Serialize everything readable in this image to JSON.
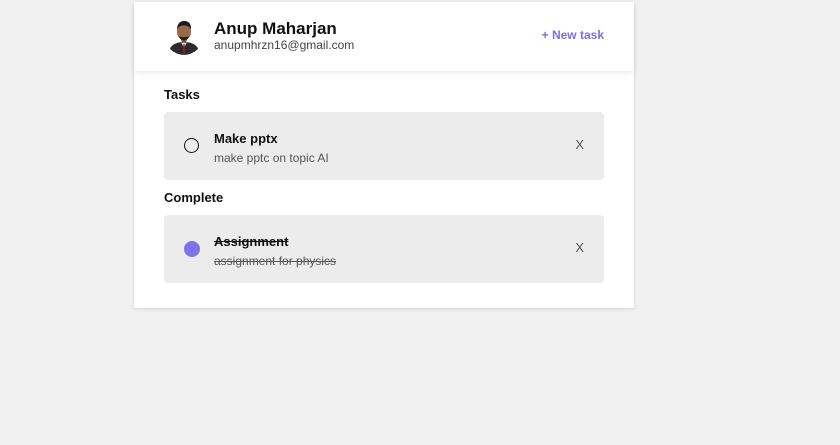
{
  "user": {
    "name": "Anup Maharjan",
    "email": "anupmhrzn16@gmail.com"
  },
  "header": {
    "new_task_label": "+ New task"
  },
  "sections": {
    "tasks_title": "Tasks",
    "complete_title": "Complete"
  },
  "tasks": [
    {
      "title": "Make pptx",
      "description": "make pptc on topic AI",
      "completed": false,
      "delete_label": "X"
    }
  ],
  "completed": [
    {
      "title": "Assignment",
      "description": "assignment for physics",
      "completed": true,
      "delete_label": "X"
    }
  ],
  "colors": {
    "accent": "#7b6fe0",
    "completed_indicator": "#7b74e6",
    "task_bg": "#ececec",
    "page_bg": "#f1f1f1"
  }
}
